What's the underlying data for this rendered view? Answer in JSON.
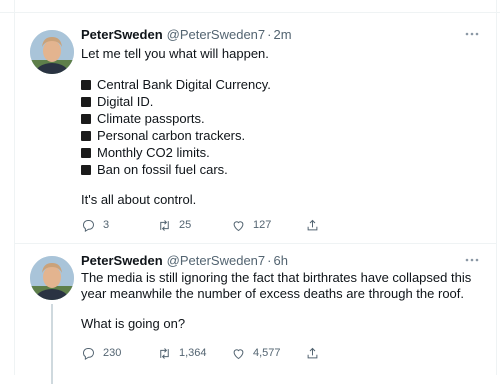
{
  "tweets": [
    {
      "display_name": "PeterSweden",
      "handle": "@PeterSweden7",
      "separator": "·",
      "time": "2m",
      "intro": "Let me tell you what will happen.",
      "list": [
        "Central Bank Digital Currency.",
        "Digital ID.",
        "Climate passports.",
        "Personal carbon trackers.",
        "Monthly CO2 limits.",
        "Ban on fossil fuel cars."
      ],
      "closing": "It's all about control.",
      "replies": "3",
      "retweets": "25",
      "likes": "127"
    },
    {
      "display_name": "PeterSweden",
      "handle": "@PeterSweden7",
      "separator": "·",
      "time": "6h",
      "text": "The media is still ignoring the fact that birthrates have collapsed this year meanwhile the number of excess deaths are through the roof.",
      "closing": "What is going on?",
      "replies": "230",
      "retweets": "1,364",
      "likes": "4,577"
    }
  ],
  "icons": {
    "reply": "reply-icon",
    "retweet": "retweet-icon",
    "like": "heart-icon",
    "share": "share-icon",
    "more": "more-icon"
  }
}
